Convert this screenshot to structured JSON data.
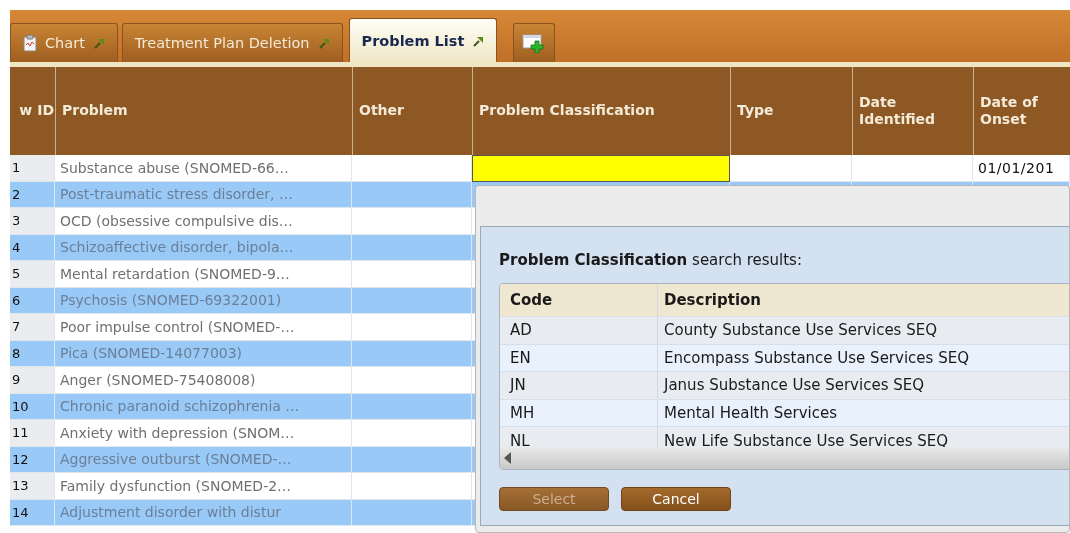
{
  "tabs": [
    {
      "label": "Chart",
      "selected": false
    },
    {
      "label": "Treatment Plan Deletion",
      "selected": false
    },
    {
      "label": "Problem List",
      "selected": true
    }
  ],
  "table": {
    "columns": [
      "w ID",
      "Problem",
      "Other",
      "Problem Classification",
      "Type",
      "Date Identified",
      "Date of Onset"
    ],
    "rows": [
      {
        "id": "1",
        "problem": "Substance abuse (SNOMED-66…",
        "classification_editing": true,
        "date_of_onset": "01/01/201"
      },
      {
        "id": "2",
        "problem": "Post-traumatic stress disorder, …"
      },
      {
        "id": "3",
        "problem": "OCD (obsessive compulsive dis…"
      },
      {
        "id": "4",
        "problem": "Schizoaffective disorder, bipola…"
      },
      {
        "id": "5",
        "problem": "Mental retardation (SNOMED-9…"
      },
      {
        "id": "6",
        "problem": "Psychosis (SNOMED-69322001)"
      },
      {
        "id": "7",
        "problem": "Poor impulse control (SNOMED-…"
      },
      {
        "id": "8",
        "problem": "Pica (SNOMED-14077003)"
      },
      {
        "id": "9",
        "problem": "Anger (SNOMED-75408008)"
      },
      {
        "id": "10",
        "problem": "Chronic paranoid schizophrenia …"
      },
      {
        "id": "11",
        "problem": "Anxiety with depression (SNOM…"
      },
      {
        "id": "12",
        "problem": "Aggressive outburst (SNOMED-…"
      },
      {
        "id": "13",
        "problem": "Family dysfunction (SNOMED-2…"
      },
      {
        "id": "14",
        "problem": "Adjustment disorder with distur"
      }
    ]
  },
  "search_dialog": {
    "heading": "**Problem Classification** search results:",
    "columns": [
      "Code",
      "Description"
    ],
    "rows": [
      {
        "code": "AD",
        "description": "County Substance Use Services SEQ"
      },
      {
        "code": "EN",
        "description": "Encompass Substance Use Services SEQ"
      },
      {
        "code": "JN",
        "description": "Janus Substance Use Services SEQ"
      },
      {
        "code": "MH",
        "description": "Mental Health Services"
      },
      {
        "code": "NL",
        "description": "New Life Substance Use Services SEQ"
      }
    ],
    "buttons": [
      {
        "label": "Select",
        "disabled": true
      },
      {
        "label": "Cancel",
        "disabled": false
      }
    ]
  }
}
